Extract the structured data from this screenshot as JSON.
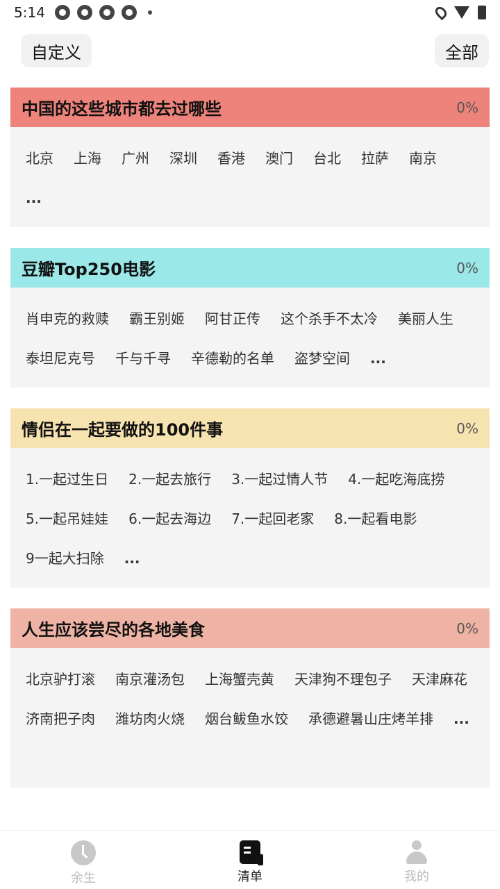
{
  "status_bar": {
    "time": "5:14"
  },
  "top_bar": {
    "custom_label": "自定义",
    "all_label": "全部"
  },
  "lists": [
    {
      "title": "中国的这些城市都去过哪些",
      "percent": "0%",
      "header_color": "#ee837b",
      "items": [
        "北京",
        "上海",
        "广州",
        "深圳",
        "香港",
        "澳门",
        "台北",
        "拉萨",
        "南京",
        "..."
      ]
    },
    {
      "title": "豆瓣Top250电影",
      "percent": "0%",
      "header_color": "#9ae8e8",
      "items": [
        "肖申克的救赎",
        "霸王别姬",
        "阿甘正传",
        "这个杀手不太冷",
        "美丽人生",
        "泰坦尼克号",
        "千与千寻",
        "辛德勒的名单",
        "盗梦空间",
        "..."
      ]
    },
    {
      "title": "情侣在一起要做的100件事",
      "percent": "0%",
      "header_color": "#f7e3b0",
      "items": [
        "1.一起过生日",
        "2.一起去旅行",
        "3.一起过情人节",
        "4.一起吃海底捞",
        "5.一起吊娃娃",
        "6.一起去海边",
        "7.一起回老家",
        "8.一起看电影",
        "9一起大扫除",
        "..."
      ]
    },
    {
      "title": "人生应该尝尽的各地美食",
      "percent": "0%",
      "header_color": "#eeb3a4",
      "items": [
        "北京驴打滚",
        "南京灌汤包",
        "上海蟹壳黄",
        "天津狗不理包子",
        "天津麻花",
        "济南把子肉",
        "潍坊肉火烧",
        "烟台鲅鱼水饺",
        "承德避暑山庄烤羊排",
        "..."
      ]
    }
  ],
  "bottom_nav": {
    "items": [
      {
        "label": "余生",
        "icon": "clock-icon",
        "active": false
      },
      {
        "label": "清单",
        "icon": "list-icon",
        "active": true
      },
      {
        "label": "我的",
        "icon": "person-icon",
        "active": false
      }
    ]
  }
}
